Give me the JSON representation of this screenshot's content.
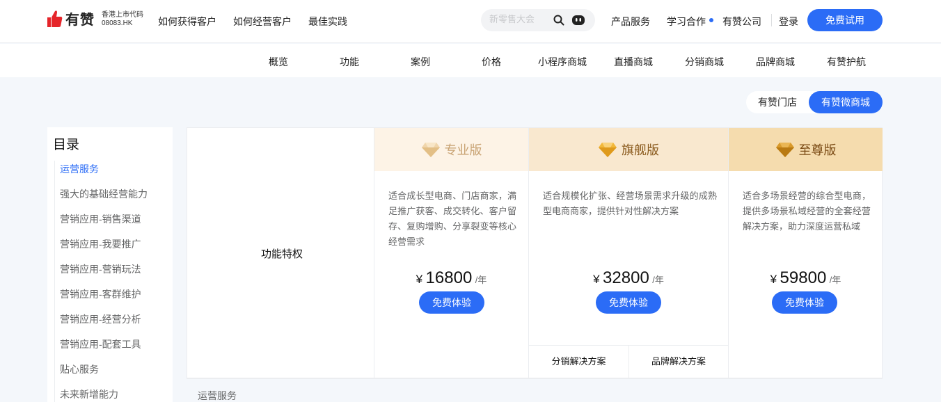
{
  "header": {
    "brand": "有赞",
    "brand_sub_line1": "香港上市代码",
    "brand_sub_line2": "08083.HK",
    "nav": [
      "如何获得客户",
      "如何经营客户",
      "最佳实践"
    ],
    "search_placeholder": "新零售大会",
    "right_nav": [
      "产品服务",
      "学习合作",
      "有赞公司"
    ],
    "login": "登录",
    "trial_button": "免费试用",
    "accent_color": "#2b6cf6"
  },
  "subnav": [
    "概览",
    "功能",
    "案例",
    "价格",
    "小程序商城",
    "直播商城",
    "分销商城",
    "品牌商城",
    "有赞护航"
  ],
  "toggle": {
    "option_store": "有赞门店",
    "option_mall": "有赞微商城",
    "selected": "有赞微商城"
  },
  "toc": {
    "title": "目录",
    "items": [
      "运营服务",
      "强大的基础经营能力",
      "营销应用-销售渠道",
      "营销应用-我要推广",
      "营销应用-营销玩法",
      "营销应用-客群维护",
      "营销应用-经营分析",
      "营销应用-配套工具",
      "贴心服务",
      "未来新增能力"
    ],
    "active": "运营服务"
  },
  "pricing": {
    "feature_label": "功能特权",
    "plans": [
      {
        "name": "专业版",
        "icon": "diamond-icon",
        "header_color": "#fdf3e6",
        "name_color": "#c8a272",
        "description": "适合成长型电商、门店商家，满足推广获客、成交转化、客户留存、复购增购、分享裂变等核心经营需求",
        "currency": "¥",
        "price": "16800",
        "unit": "/年",
        "button": "免费体验"
      },
      {
        "name": "旗舰版",
        "icon": "diamond-icon",
        "header_color": "#f9e8cf",
        "name_color": "#8a5a1d",
        "description": "适合规模化扩张、经营场景需求升级的成熟型电商商家，提供针对性解决方案",
        "currency": "¥",
        "price": "32800",
        "unit": "/年",
        "button": "免费体验",
        "sub_solutions": [
          "分销解决方案",
          "品牌解决方案"
        ]
      },
      {
        "name": "至尊版",
        "icon": "diamond-icon",
        "header_color": "#f5dcae",
        "name_color": "#7a4a14",
        "description": "适合多场景经营的综合型电商，提供多场景私域经营的全套经营解决方案，助力深度运营私域",
        "currency": "¥",
        "price": "59800",
        "unit": "/年",
        "button": "免费体验"
      }
    ]
  },
  "section": {
    "label": "运营服务"
  }
}
